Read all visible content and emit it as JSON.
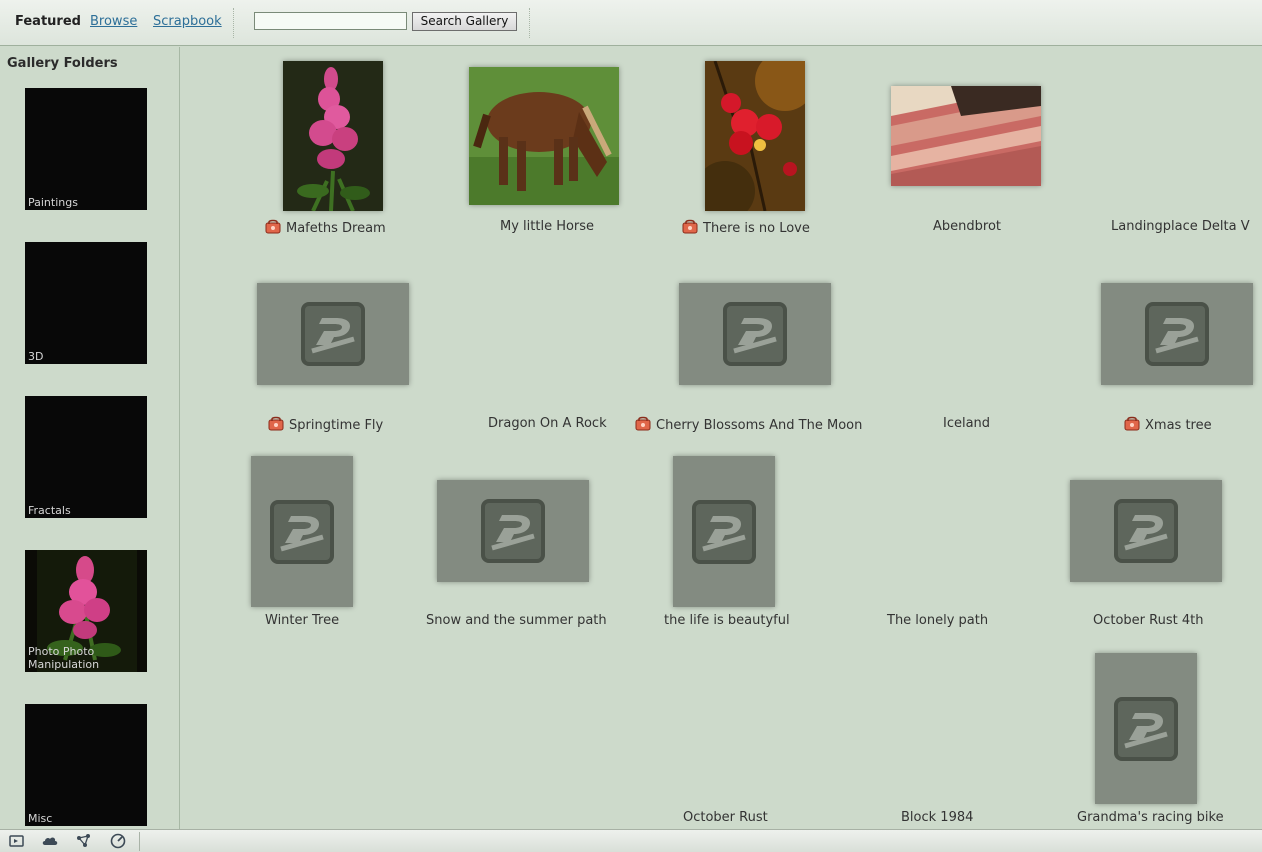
{
  "nav": {
    "featured": "Featured",
    "browse": "Browse",
    "scrapbook": "Scrapbook",
    "search_value": "",
    "search_button": "Search Gallery"
  },
  "sidebar": {
    "title": "Gallery Folders",
    "folders": [
      {
        "label": "Paintings"
      },
      {
        "label": "3D"
      },
      {
        "label": "Fractals"
      },
      {
        "label": "Photo Photo Manipulation"
      },
      {
        "label": "Misc"
      }
    ]
  },
  "gallery": {
    "items": [
      {
        "title": "Mafeths Dream",
        "mature": true,
        "image": "pink-flower-photo"
      },
      {
        "title": "My little Horse",
        "mature": false,
        "image": "horse-photo"
      },
      {
        "title": "There is no Love",
        "mature": true,
        "image": "red-flower-photo"
      },
      {
        "title": "Abendbrot",
        "mature": false,
        "image": "bread-photo"
      },
      {
        "title": "Landingplace Delta V",
        "mature": false,
        "image": "none"
      },
      {
        "title": "Springtime Fly",
        "mature": true,
        "image": "placeholder"
      },
      {
        "title": "Dragon On A Rock",
        "mature": false,
        "image": "none"
      },
      {
        "title": "Cherry Blossoms And The Moon",
        "mature": true,
        "image": "placeholder"
      },
      {
        "title": "Iceland",
        "mature": false,
        "image": "none"
      },
      {
        "title": "Xmas tree",
        "mature": true,
        "image": "placeholder"
      },
      {
        "title": "Winter Tree",
        "mature": false,
        "image": "placeholder"
      },
      {
        "title": "Snow and the summer path",
        "mature": false,
        "image": "placeholder"
      },
      {
        "title": "the life is beautyful",
        "mature": false,
        "image": "placeholder"
      },
      {
        "title": "The lonely path",
        "mature": false,
        "image": "none"
      },
      {
        "title": "October Rust 4th",
        "mature": false,
        "image": "placeholder"
      },
      {
        "title": "October Rust",
        "mature": false,
        "image": "none"
      },
      {
        "title": "Block 1984",
        "mature": false,
        "image": "none"
      },
      {
        "title": "Grandma's racing bike",
        "mature": false,
        "image": "placeholder"
      }
    ]
  },
  "bottombar": {
    "icons": [
      "media-icon",
      "cloud-icon",
      "share-icon",
      "gauge-icon"
    ]
  },
  "colors": {
    "background": "#cddacb",
    "link": "#2d6f98",
    "placeholder": "#838b81",
    "mature_badge": "#e0664a"
  }
}
